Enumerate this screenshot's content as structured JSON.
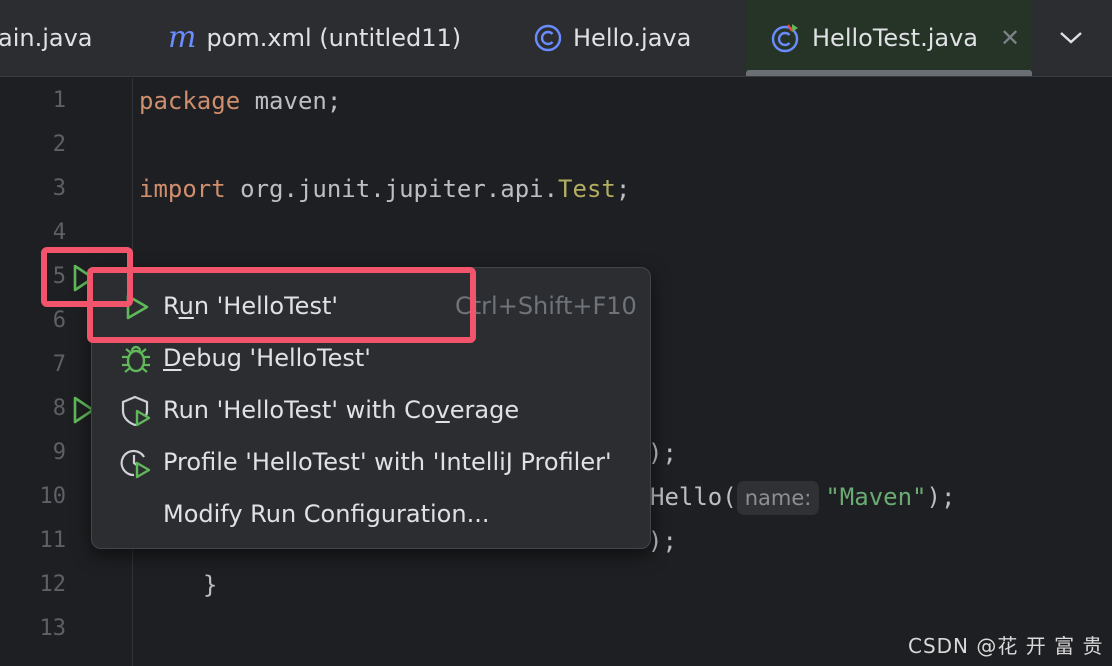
{
  "tabs": [
    {
      "label": "ain.java",
      "icon": "java-class-icon",
      "active": false
    },
    {
      "label": "pom.xml (untitled11)",
      "icon": "maven-icon",
      "active": false
    },
    {
      "label": "Hello.java",
      "icon": "java-class-icon",
      "active": false
    },
    {
      "label": "HelloTest.java",
      "icon": "java-test-class-icon",
      "active": true,
      "close": "✕"
    }
  ],
  "editor": {
    "line_numbers": [
      "1",
      "2",
      "3",
      "4",
      "5",
      "6",
      "7",
      "8",
      "9",
      "10",
      "11",
      "12",
      "13"
    ],
    "code": {
      "l1_kw": "package",
      "l1_rest": " maven;",
      "l3_kw": "import",
      "l3_pkg": " org.junit.jupiter.api.",
      "l3_cls": "Test",
      "l3_end": ";",
      "l9_tail": ");",
      "l10_call": "Hello(",
      "l10_hint": "name:",
      "l10_str": "\"Maven\"",
      "l10_end": ");",
      "l11_tail": ");",
      "l12": "}"
    }
  },
  "context_menu": {
    "items": [
      {
        "label_prefix": "R",
        "label_mnemonic": "u",
        "label_suffix": "n 'HelloTest'",
        "shortcut": "Ctrl+Shift+F10",
        "icon": "run-icon"
      },
      {
        "label_prefix": "",
        "label_mnemonic": "D",
        "label_suffix": "ebug 'HelloTest'",
        "icon": "debug-bug-icon"
      },
      {
        "label_prefix": "Run 'HelloTest' with Co",
        "label_mnemonic": "v",
        "label_suffix": "erage",
        "icon": "coverage-shield-icon"
      },
      {
        "label_prefix": "Profile 'HelloTest' with 'IntelliJ Profiler'",
        "label_mnemonic": "",
        "label_suffix": "",
        "icon": "profiler-clock-icon"
      },
      {
        "label_prefix": "Modify Run Configuration...",
        "label_mnemonic": "",
        "label_suffix": "",
        "icon": ""
      }
    ]
  },
  "watermark": "CSDN @花 开 富 贵",
  "colors": {
    "background": "#1e1f22",
    "keyword": "#cf8e6d",
    "string": "#6aab73",
    "annotation_red": "#f2546b",
    "run_green": "#5fb85a"
  }
}
